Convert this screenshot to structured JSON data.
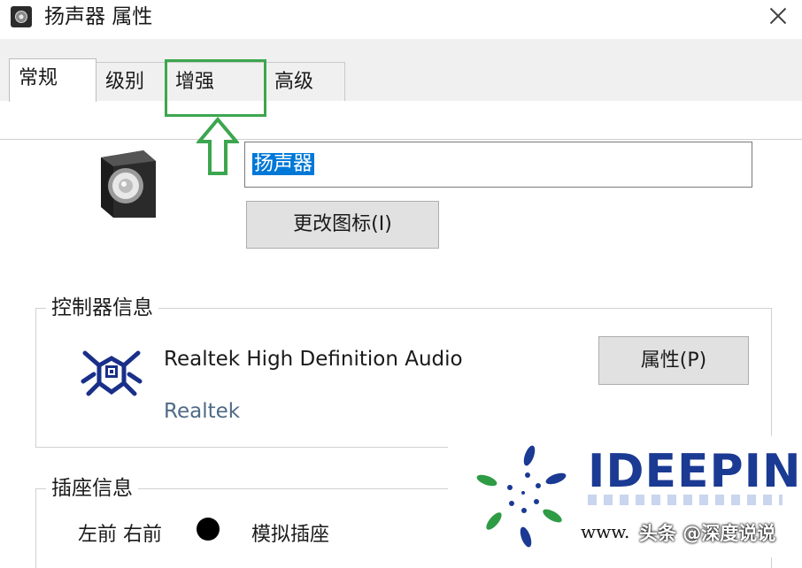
{
  "window": {
    "title": "扬声器 属性"
  },
  "tabs": [
    {
      "label": "常规",
      "active": true
    },
    {
      "label": "级别",
      "active": false
    },
    {
      "label": "增强",
      "active": false
    },
    {
      "label": "高级",
      "active": false
    }
  ],
  "device": {
    "name_value": "扬声器",
    "change_icon_label": "更改图标(I)"
  },
  "controller": {
    "legend": "控制器信息",
    "name": "Realtek High Definition Audio",
    "vendor": "Realtek",
    "properties_label": "属性(P)"
  },
  "jack": {
    "legend": "插座信息",
    "position": "左前 右前",
    "color": "#000000",
    "type": "模拟插座"
  },
  "annotations": {
    "highlight_color": "#3ca64e",
    "highlighted_tab": "增强"
  },
  "watermark": {
    "brand": "IDEEPIN",
    "url_text": "www.",
    "caption": "头条 @深度说说"
  },
  "icons": {
    "app": "speaker-app-icon",
    "device": "speaker-icon",
    "controller": "realtek-logo-icon",
    "close": "close-icon"
  }
}
